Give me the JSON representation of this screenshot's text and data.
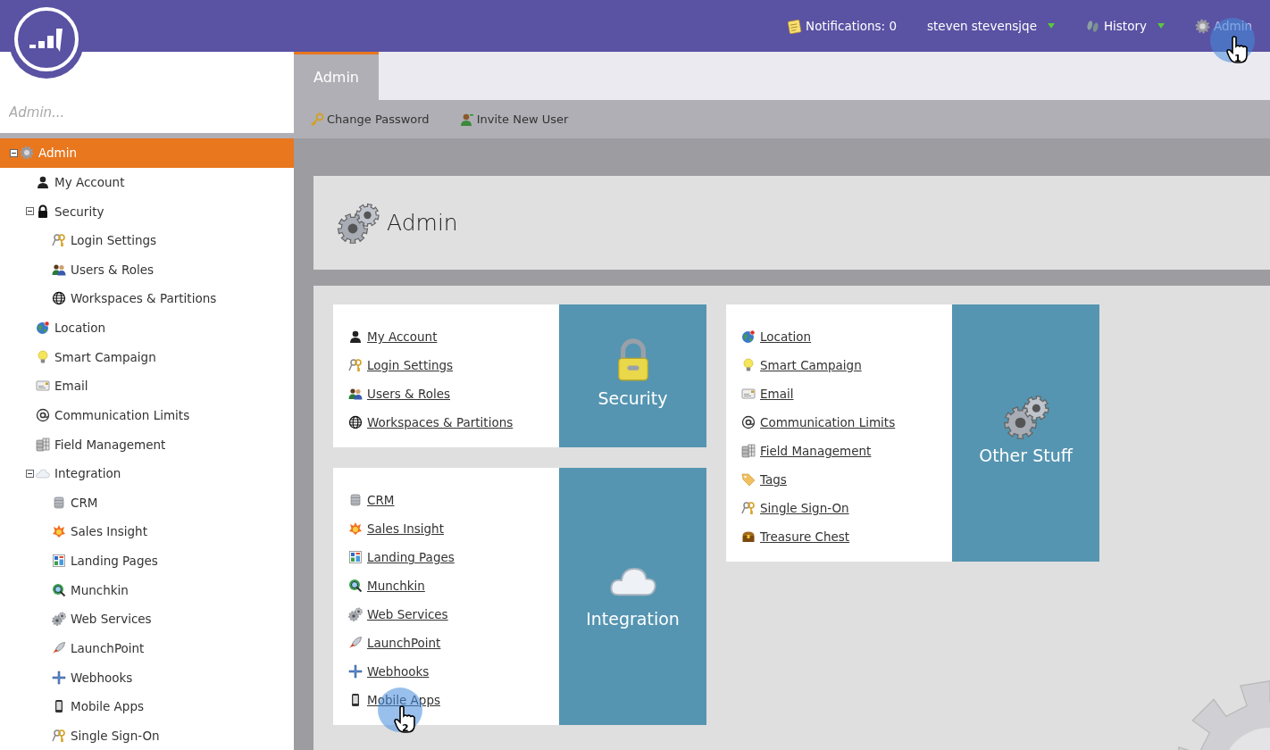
{
  "top_bar": {
    "items": [
      {
        "label": "Notifications: 0",
        "dropdown": false
      },
      {
        "label": "steven stevensjqe",
        "dropdown": true
      },
      {
        "label": "History",
        "dropdown": true
      },
      {
        "label": "Admin",
        "dropdown": false
      }
    ]
  },
  "sidebar": {
    "search": {
      "placeholder": "Admin..."
    },
    "tree": [
      {
        "label": "Admin",
        "selected": true,
        "expanded": true,
        "children": [
          {
            "label": "My Account",
            "selected": false
          },
          {
            "label": "Security",
            "selected": false,
            "expanded": true,
            "children": [
              {
                "label": "Login Settings",
                "selected": false
              },
              {
                "label": "Users & Roles",
                "selected": false
              },
              {
                "label": "Workspaces & Partitions",
                "selected": false
              }
            ]
          },
          {
            "label": "Location",
            "selected": false
          },
          {
            "label": "Smart Campaign",
            "selected": false
          },
          {
            "label": "Email",
            "selected": false
          },
          {
            "label": "Communication Limits",
            "selected": false
          },
          {
            "label": "Field Management",
            "selected": false
          },
          {
            "label": "Integration",
            "selected": false,
            "expanded": true,
            "children": [
              {
                "label": "CRM",
                "selected": false
              },
              {
                "label": "Sales Insight",
                "selected": false
              },
              {
                "label": "Landing Pages",
                "selected": false
              },
              {
                "label": "Munchkin",
                "selected": false
              },
              {
                "label": "Web Services",
                "selected": false
              },
              {
                "label": "LaunchPoint",
                "selected": false
              },
              {
                "label": "Webhooks",
                "selected": false
              },
              {
                "label": "Mobile Apps",
                "selected": false
              },
              {
                "label": "Single Sign-On",
                "selected": false
              }
            ]
          }
        ]
      }
    ]
  },
  "tabs": [
    {
      "label": "Admin",
      "selected": true
    }
  ],
  "toolbar": [
    "Change Password",
    "Invite New User"
  ],
  "header": {
    "title": "Admin"
  },
  "cards": [
    {
      "title": "Security",
      "links": [
        "My Account",
        "Login Settings",
        "Users & Roles",
        "Workspaces & Partitions"
      ]
    },
    {
      "title": "Integration",
      "links": [
        "CRM",
        "Sales Insight",
        "Landing Pages",
        "Munchkin",
        "Web Services",
        "LaunchPoint",
        "Webhooks",
        "Mobile Apps"
      ]
    },
    {
      "title": "Other Stuff",
      "links": [
        "Location",
        "Smart Campaign",
        "Email",
        "Communication Limits",
        "Field Management",
        "Tags",
        "Single Sign-On",
        "Treasure Chest"
      ]
    }
  ],
  "cursor_callouts": [
    {
      "label": "1"
    },
    {
      "label": "2"
    }
  ]
}
